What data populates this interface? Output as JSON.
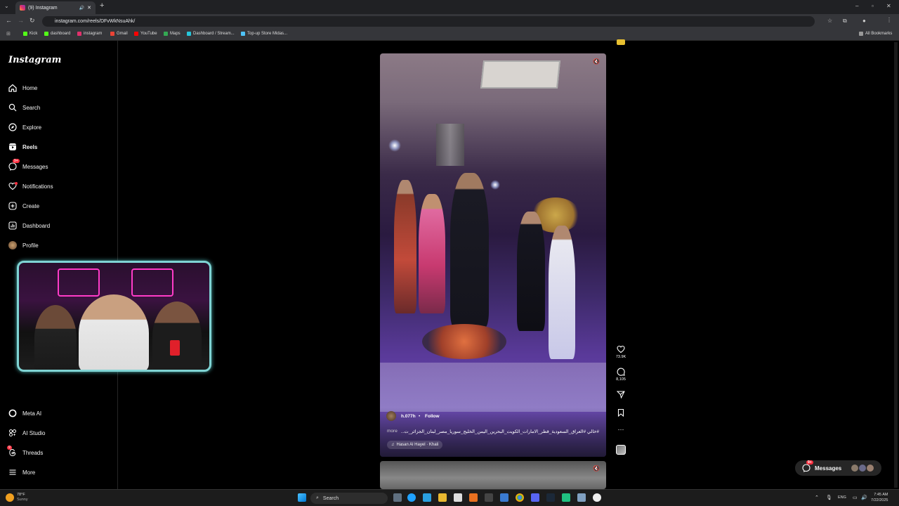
{
  "browser": {
    "tab_title": "(9) Instagram",
    "url": "instagram.com/reels/DFvWkNsuAhk/",
    "bookmarks": [
      "Kick",
      "dashboard",
      "instagram",
      "Gmail",
      "YouTube",
      "Maps",
      "Dashboard / Stream...",
      "Top-up Store Midas..."
    ],
    "all_bookmarks": "All Bookmarks"
  },
  "sidebar": {
    "logo": "Instagram",
    "items": [
      {
        "label": "Home",
        "icon": "home-icon"
      },
      {
        "label": "Search",
        "icon": "search-icon"
      },
      {
        "label": "Explore",
        "icon": "compass-icon"
      },
      {
        "label": "Reels",
        "icon": "reels-icon"
      },
      {
        "label": "Messages",
        "icon": "messenger-icon",
        "badge": "9+"
      },
      {
        "label": "Notifications",
        "icon": "heart-icon"
      },
      {
        "label": "Create",
        "icon": "plus-square-icon"
      },
      {
        "label": "Dashboard",
        "icon": "dashboard-icon"
      },
      {
        "label": "Profile",
        "icon": "avatar"
      }
    ],
    "bottom_items": [
      {
        "label": "Meta AI",
        "icon": "meta-ai-icon"
      },
      {
        "label": "AI Studio",
        "icon": "ai-studio-icon"
      },
      {
        "label": "Threads",
        "icon": "threads-icon",
        "badge": "9"
      },
      {
        "label": "More",
        "icon": "menu-icon"
      }
    ]
  },
  "reel": {
    "username": "h.077h",
    "follow_label": "Follow",
    "caption": "#خالي #العراق_السعودية_قطر_الامارات_الكويت_البحرين_اليمن_الخليج_سوريا_مصر_لبنان_الجزائر_ت...",
    "more_label": "more",
    "audio": "Hasan Al Hayel · Khali",
    "likes": "73.9K",
    "comments": "8,105"
  },
  "messages_pill": {
    "label": "Messages",
    "badge": "9+"
  },
  "taskbar": {
    "weather_temp": "78°F",
    "weather_desc": "Sunny",
    "search_label": "Search",
    "lang": "ENG",
    "time": "7:45 AM",
    "date": "7/22/2025"
  },
  "colors": {
    "accent": "#ff3040",
    "webcam_border": "#7fd4d4"
  }
}
